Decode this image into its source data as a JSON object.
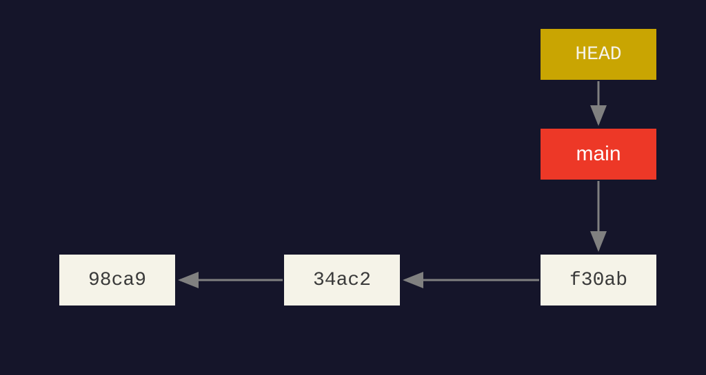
{
  "diagram": {
    "head": {
      "label": "HEAD"
    },
    "branch": {
      "label": "main"
    },
    "commits": [
      {
        "hash": "98ca9"
      },
      {
        "hash": "34ac2"
      },
      {
        "hash": "f30ab"
      }
    ]
  }
}
